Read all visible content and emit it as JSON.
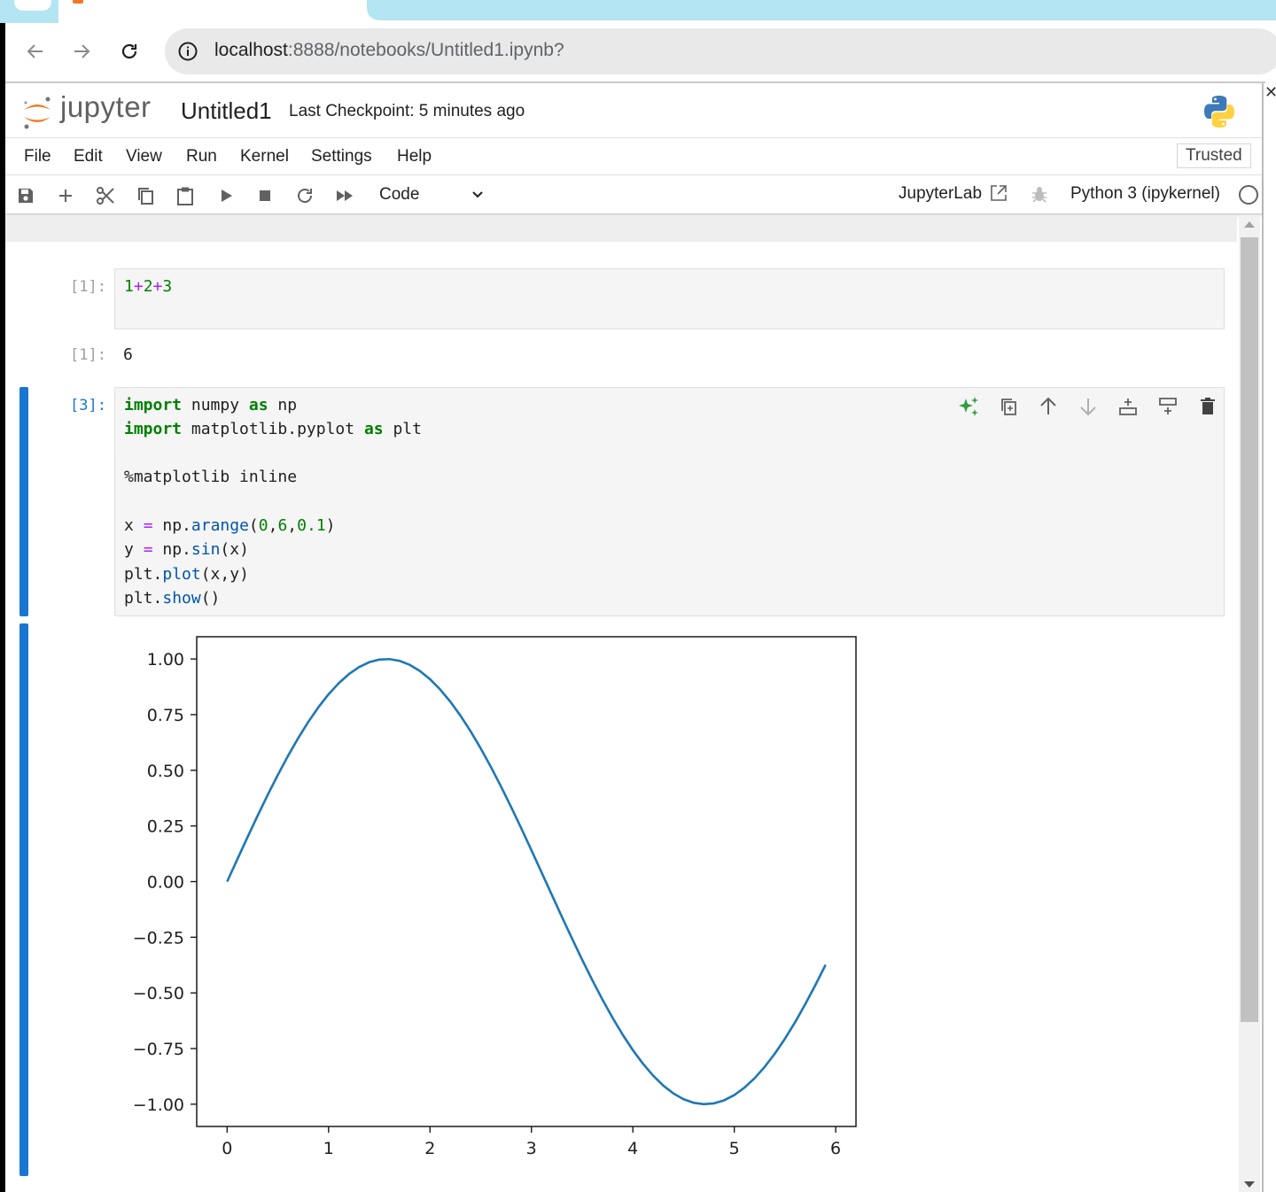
{
  "browser": {
    "url_host": "localhost",
    "url_path": ":8888/notebooks/Untitled1.ipynb?"
  },
  "header": {
    "logo_text": "jupyter",
    "title": "Untitled1",
    "checkpoint": "Last Checkpoint: 5 minutes ago"
  },
  "menu": {
    "items": [
      "File",
      "Edit",
      "View",
      "Run",
      "Kernel",
      "Settings",
      "Help"
    ],
    "trusted": "Trusted"
  },
  "toolbar": {
    "cell_type": "Code",
    "jupyterlab_link": "JupyterLab",
    "kernel": "Python 3 (ipykernel)"
  },
  "colors": {
    "accent": "#1976d2",
    "jupyter_orange": "#f37726",
    "line_series": "#1f77b4"
  },
  "cells": [
    {
      "prompt": "[1]:",
      "source": [
        "1+2+3"
      ],
      "output_prompt": "[1]:",
      "output": "6"
    },
    {
      "prompt": "[3]:",
      "source": [
        "import numpy as np",
        "import matplotlib.pyplot as plt",
        "",
        "%matplotlib inline",
        "",
        "x = np.arange(0,6,0.1)",
        "y = np.sin(x)",
        "plt.plot(x,y)",
        "plt.show()"
      ]
    }
  ],
  "chart_data": {
    "type": "line",
    "function": "sin",
    "x_start": 0,
    "x_stop": 6,
    "x_step": 0.1,
    "xlim": [
      -0.3,
      6.2
    ],
    "ylim": [
      -1.1,
      1.1
    ],
    "xticks": [
      0,
      1,
      2,
      3,
      4,
      5,
      6
    ],
    "yticks": [
      1.0,
      0.75,
      0.5,
      0.25,
      0.0,
      -0.25,
      -0.5,
      -0.75,
      -1.0
    ],
    "xtick_labels": [
      "0",
      "1",
      "2",
      "3",
      "4",
      "5",
      "6"
    ],
    "ytick_labels": [
      "1.00",
      "0.75",
      "0.50",
      "0.25",
      "0.00",
      "−0.25",
      "−0.50",
      "−0.75",
      "−1.00"
    ],
    "grid": false,
    "title": "",
    "xlabel": "",
    "ylabel": ""
  }
}
